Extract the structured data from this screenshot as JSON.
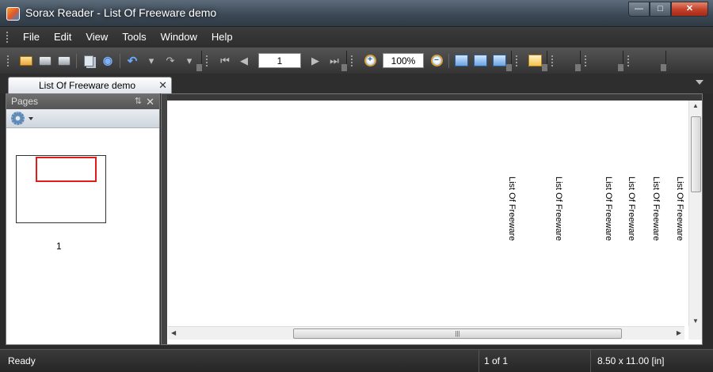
{
  "window": {
    "title": "Sorax Reader - List Of Freeware demo",
    "minimize_icon": "minimize-icon",
    "maximize_icon": "maximize-icon",
    "close_icon": "close-icon"
  },
  "menu": {
    "items": [
      "File",
      "Edit",
      "View",
      "Tools",
      "Window",
      "Help"
    ]
  },
  "toolbar": {
    "page_number": "1",
    "zoom": "100%",
    "icons": [
      "open-icon",
      "print-icon",
      "print-setup-icon",
      "copy-icon",
      "find-icon",
      "undo-icon",
      "redo-icon",
      "first-page-icon",
      "prev-page-icon",
      "next-page-icon",
      "last-page-icon",
      "zoom-in-icon",
      "zoom-out-icon",
      "fit-width-icon",
      "fit-page-icon",
      "actual-size-icon",
      "single-page-icon"
    ]
  },
  "tabs": [
    {
      "label": "List Of Freeware demo",
      "active": true
    }
  ],
  "pages_panel": {
    "title": "Pages",
    "thumbnail_label": "1"
  },
  "document": {
    "rotated_texts": [
      "List Of Freeware",
      "List Of Freeware",
      "List Of Freeware",
      "List Of Freeware",
      "List Of Freeware",
      "List Of Freeware"
    ]
  },
  "status": {
    "left": "Ready",
    "page": "1 of 1",
    "size": "8.50 x 11.00 [in]"
  },
  "colors": {
    "accent_red": "#e21b1b",
    "chrome_dark": "#2e2e2e",
    "statusbar": "#262626"
  }
}
